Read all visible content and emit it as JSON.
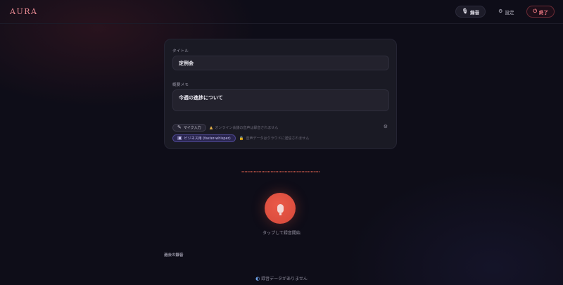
{
  "app": {
    "logo": "AURA"
  },
  "header": {
    "record_label": "録音",
    "settings_label": "設定",
    "exit_label": "終了"
  },
  "form": {
    "title_label": "タイトル",
    "title_value": "定例会",
    "memo_label": "概要メモ",
    "memo_value": "今週の進捗について",
    "mic_chip": "マイク入力",
    "mic_note": "オンライン会議の音声は録音されません",
    "model_chip": "ビジネス用 (faster-whisper)",
    "model_note": "音声データはクラウドに送信されません"
  },
  "recorder": {
    "tap_label": "タップして録音開始"
  },
  "history": {
    "section_label": "過去の録音",
    "empty_label": "録音データがありません"
  },
  "colors": {
    "accent": "#e0604e",
    "logo": "#e88a92",
    "model_chip": "#4d4790",
    "exit": "#f07a84"
  },
  "icons": {
    "record": "mic-icon",
    "settings": "gear-icon",
    "exit": "exit-icon",
    "mic_chip": "microphone-icon",
    "warning": "warning-icon",
    "model": "robot-icon",
    "lock": "lock-icon",
    "options": "gear-icon",
    "empty": "waveform-icon"
  }
}
